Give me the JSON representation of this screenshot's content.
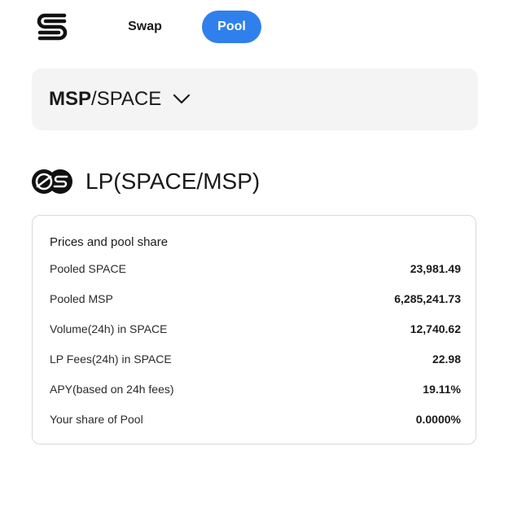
{
  "header": {
    "logo_icon": "s-logo-icon",
    "tabs": [
      {
        "label": "Swap",
        "active": false
      },
      {
        "label": "Pool",
        "active": true
      }
    ],
    "active_color": "#2f80ed"
  },
  "pair_selector": {
    "base": "MSP",
    "separator": "/",
    "quote": "SPACE",
    "icon": "chevron-down-icon"
  },
  "lp": {
    "icon": "lp-token-icon",
    "title": "LP(SPACE/MSP)"
  },
  "pool_card": {
    "title": "Prices and pool share",
    "rows": [
      {
        "label": "Pooled SPACE",
        "value": "23,981.49"
      },
      {
        "label": "Pooled MSP",
        "value": "6,285,241.73"
      },
      {
        "label": "Volume(24h) in SPACE",
        "value": "12,740.62"
      },
      {
        "label": "LP Fees(24h) in SPACE",
        "value": "22.98"
      },
      {
        "label": "APY(based on 24h fees)",
        "value": "19.11%"
      },
      {
        "label": "Your share of Pool",
        "value": "0.0000%"
      }
    ]
  }
}
